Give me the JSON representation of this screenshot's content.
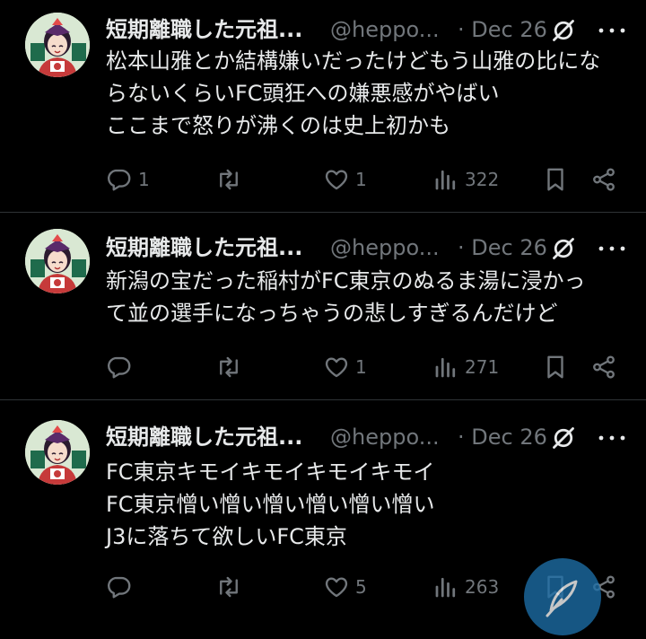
{
  "colors": {
    "background": "#000000",
    "text": "#e7e9ea",
    "muted": "#71767b",
    "divider": "#2f3336",
    "fab": "#1d6fa8"
  },
  "tweets": [
    {
      "name": "短期離職した元祖...",
      "handle": "@heppo...",
      "dot": "·",
      "date": "Dec 26",
      "lines": [
        "松本山雅とか結構嫌いだったけどもう山雅の比にな",
        "らないくらいFC頭狂への嫌悪感がやばい",
        "ここまで怒りが沸くのは史上初かも"
      ],
      "reply_count": "1",
      "retweet_count": "",
      "like_count": "1",
      "view_count": "322"
    },
    {
      "name": "短期離職した元祖...",
      "handle": "@heppo...",
      "dot": "·",
      "date": "Dec 26",
      "lines": [
        "新潟の宝だった稲村がFC東京のぬるま湯に浸かっ",
        "て並の選手になっちゃうの悲しすぎるんだけど"
      ],
      "reply_count": "",
      "retweet_count": "",
      "like_count": "1",
      "view_count": "271"
    },
    {
      "name": "短期離職した元祖...",
      "handle": "@heppo...",
      "dot": "·",
      "date": "Dec 26",
      "lines": [
        "FC東京キモイキモイキモイキモイ",
        "FC東京憎い憎い憎い憎い憎い憎い",
        "J3に落ちて欲しいFC東京"
      ],
      "reply_count": "",
      "retweet_count": "",
      "like_count": "5",
      "view_count": "263"
    }
  ],
  "icons": {
    "reply": "reply-icon",
    "retweet": "retweet-icon",
    "like": "heart-icon",
    "views": "views-icon",
    "bookmark": "bookmark-icon",
    "share": "share-icon",
    "grok": "grok-icon",
    "more": "more-icon",
    "compose": "compose-feather-icon"
  }
}
